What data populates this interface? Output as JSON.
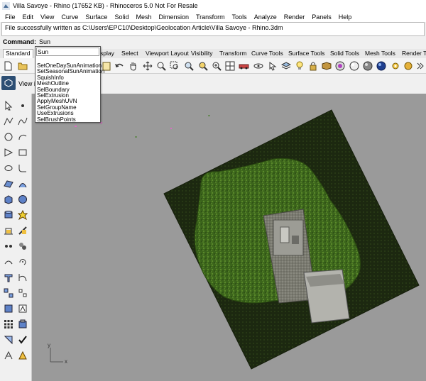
{
  "window": {
    "title": "Villa Savoye - Rhino (17652 KB) - Rhinoceros 5.0 Not For Resale"
  },
  "menu": [
    "File",
    "Edit",
    "View",
    "Curve",
    "Surface",
    "Solid",
    "Mesh",
    "Dimension",
    "Transform",
    "Tools",
    "Analyze",
    "Render",
    "Panels",
    "Help"
  ],
  "command_history": "File successfully written as C:\\Users\\EPC10\\Desktop\\Geolocation Article\\Villa Savoye - Rhino.3dm",
  "command": {
    "prompt": "Command:",
    "value": "Sun"
  },
  "tabs": [
    "Standard",
    "Display",
    "Select",
    "Viewport Layout",
    "Visibility",
    "Transform",
    "Curve Tools",
    "Surface Tools",
    "Solid Tools",
    "Mesh Tools",
    "Render Tools"
  ],
  "tabs_visible": [
    "Standard",
    "splay",
    "Select",
    "Viewport Layout",
    "Visibility",
    "Transform",
    "Curve Tools",
    "Surface Tools",
    "Solid Tools",
    "Mesh Tools",
    "Render Tools"
  ],
  "viewport_label": "View in",
  "autocomplete": {
    "input": "Sun",
    "items": [
      "SetOneDaySunAnimation",
      "SetSeasonalSunAnimation",
      "SquishInfo",
      "MeshOutline",
      "SelBoundary",
      "SelExtrusion",
      "ApplyMeshUVN",
      "SetGroupName",
      "UseExtrusions",
      "SelBrushPoints"
    ]
  },
  "axes": {
    "x": "x",
    "y": "y"
  },
  "colors": {
    "viewport_bg": "#9a9a9a",
    "terrain_dark": "#1d2a12",
    "vegetation": "#3f6b1f",
    "building_roof": "#8a8a8a",
    "accent_blue": "#2c4e73"
  }
}
